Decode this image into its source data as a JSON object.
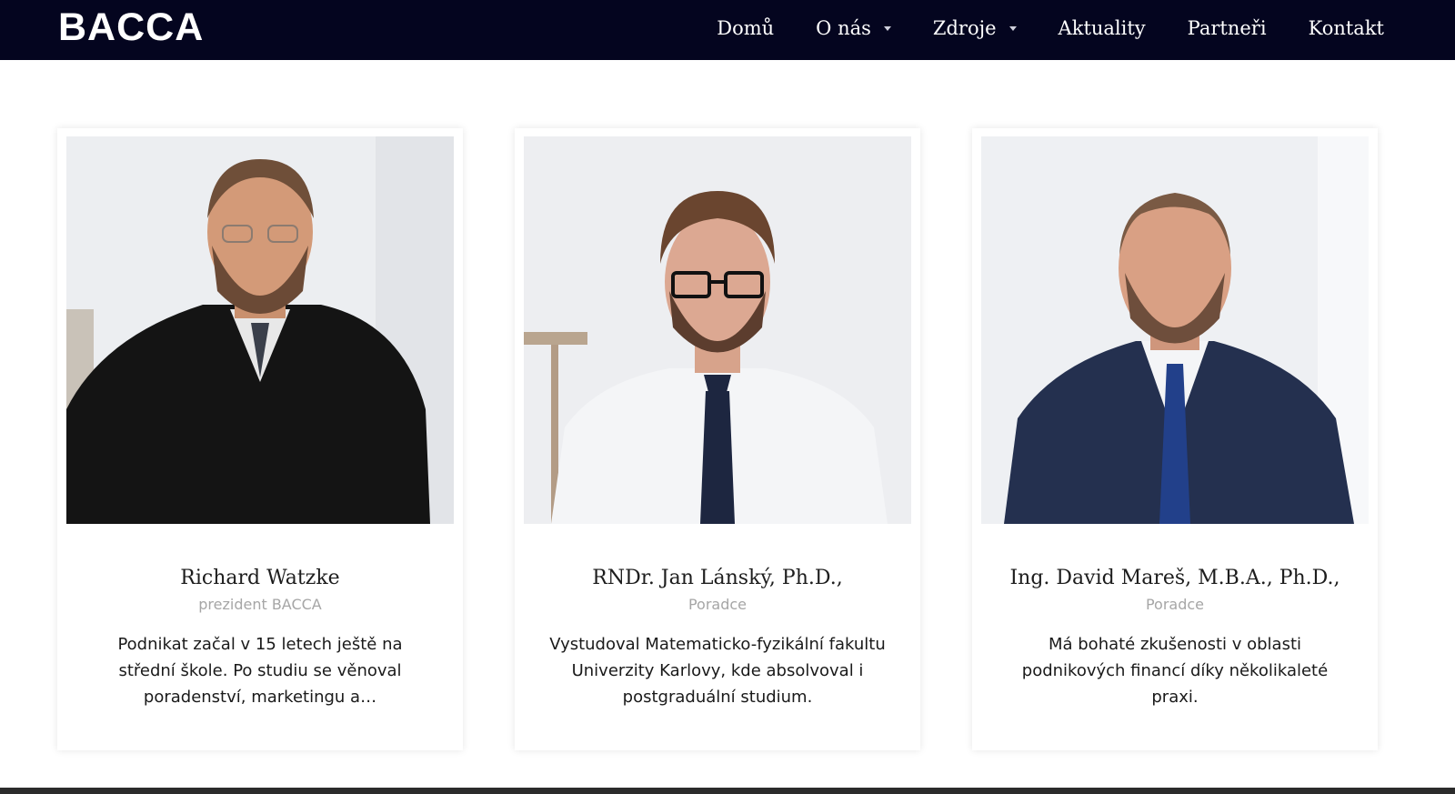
{
  "brand": {
    "logo": "BACCA",
    "nav_bg": "#04051f"
  },
  "nav": [
    {
      "label": "Domů",
      "dropdown": false
    },
    {
      "label": "O nás",
      "dropdown": true
    },
    {
      "label": "Zdroje",
      "dropdown": true
    },
    {
      "label": "Aktuality",
      "dropdown": false
    },
    {
      "label": "Partneři",
      "dropdown": false
    },
    {
      "label": "Kontakt",
      "dropdown": false
    }
  ],
  "team": [
    {
      "name": "Richard Watzke",
      "role": "prezident BACCA",
      "bio": "Podnikat začal v 15 letech ještě na střední škole. Po studiu se věnoval poradenství, marketingu a…",
      "photo": "portrait-photo"
    },
    {
      "name": "RNDr. Jan Lánský, Ph.D.,",
      "role": "Poradce",
      "bio": "Vystudoval Matematicko-fyzikální fakultu Univerzity Karlovy, kde absolvoval i postgraduální studium.",
      "photo": "portrait-photo"
    },
    {
      "name": "Ing. David Mareš, M.B.A., Ph.D.,",
      "role": "Poradce",
      "bio": "Má bohaté zkušenosti v oblasti podnikových financí díky několikaleté praxi.",
      "photo": "portrait-photo"
    }
  ]
}
